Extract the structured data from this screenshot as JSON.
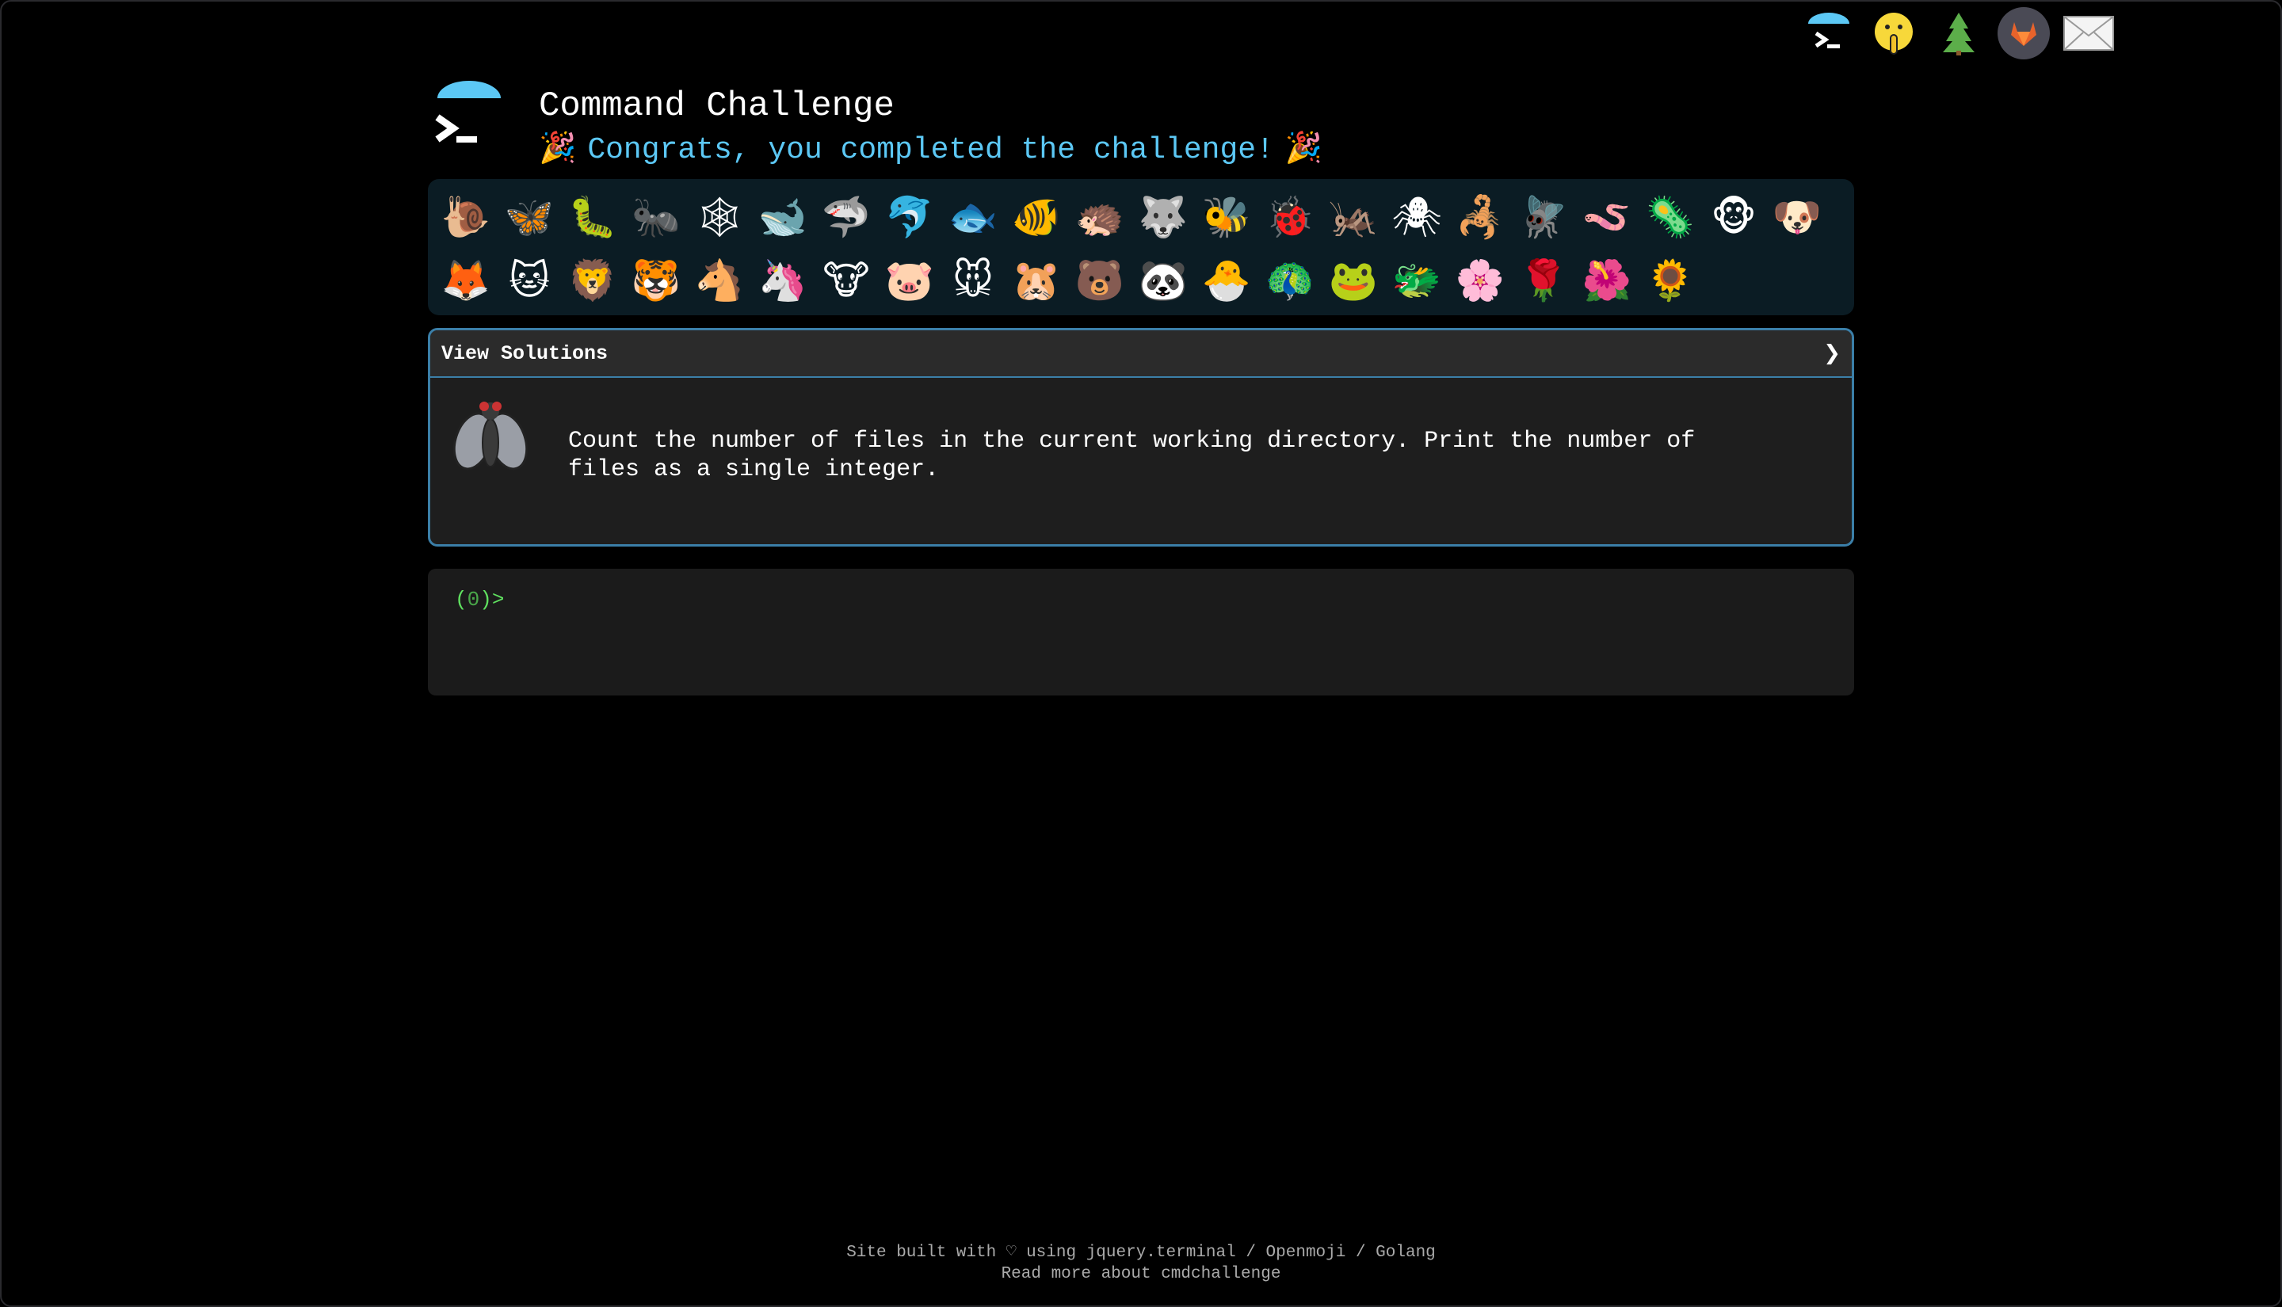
{
  "header": {
    "title": "Command Challenge",
    "congrats": "Congrats, you completed the challenge!",
    "party_emoji": "🎉"
  },
  "top_links": [
    {
      "name": "cmdchallenge-logo-icon"
    },
    {
      "name": "shushing-face-icon"
    },
    {
      "name": "tree-icon"
    },
    {
      "name": "gitlab-icon"
    },
    {
      "name": "mail-icon"
    }
  ],
  "animals": {
    "row1": [
      "🐌",
      "🦋",
      "🐛",
      "🐜",
      "🕸",
      "🐋",
      "🦈",
      "🐬",
      "🐟",
      "🐠",
      "🦔",
      "🐺",
      "🐝",
      "🐞",
      "🦗",
      "🕷",
      "🦂",
      "🪰",
      "🪱",
      "🦠",
      "🐵",
      "🐶"
    ],
    "row2": [
      "🦊",
      "🐱",
      "🦁",
      "🐯",
      "🐴",
      "🦄",
      "🐮",
      "🐷",
      "🐭",
      "🐹",
      "🐻",
      "🐼",
      "🐣",
      "🦚",
      "🐸",
      "🐲",
      "🌸",
      "🌹",
      "🌺",
      "🌻"
    ]
  },
  "challenge": {
    "solutions_label": "View Solutions",
    "chevron": "❯",
    "text": "Count the number of files in the current working directory. Print the number of files as a single integer."
  },
  "terminal": {
    "prompt_open": "(",
    "prompt_num": "0",
    "prompt_close": ")>"
  },
  "footer": {
    "line1_prefix": "Site built with ♡ using ",
    "jquery_terminal": "jquery.terminal",
    "sep1": " / ",
    "openmoji": "Openmoji",
    "sep2": " / ",
    "golang": "Golang",
    "line2": "Read more about cmdchallenge"
  },
  "colors": {
    "accent": "#5cc8f5",
    "panel_border": "#3b7fa8",
    "prompt_green": "#5fe05f"
  }
}
